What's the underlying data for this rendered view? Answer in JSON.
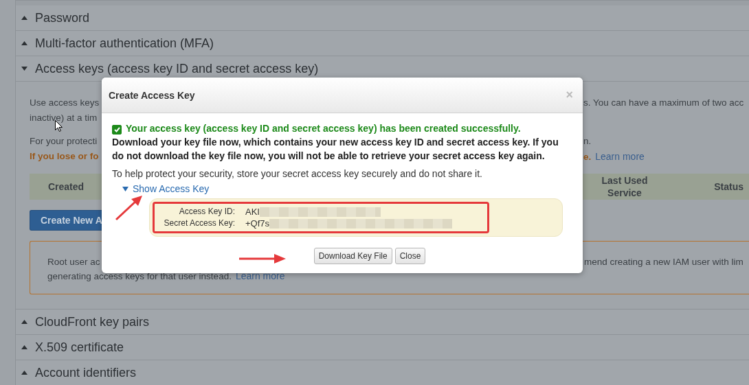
{
  "sections": [
    {
      "title": "Password",
      "expanded": false
    },
    {
      "title": "Multi-factor authentication (MFA)",
      "expanded": false
    },
    {
      "title": "Access keys (access key ID and secret access key)",
      "expanded": true
    },
    {
      "title": "CloudFront key pairs",
      "expanded": false
    },
    {
      "title": "X.509 certificate",
      "expanded": false
    },
    {
      "title": "Account identifiers",
      "expanded": false
    }
  ],
  "access_keys_body": {
    "intro": [
      {
        "left": "Use access keys",
        "right": "s. You can have a maximum of two acc"
      },
      {
        "left": "inactive) at a tim"
      }
    ],
    "protection": {
      "left": "For your protecti",
      "right": "n."
    },
    "warning_line": {
      "left": "If you lose or fo",
      "right": "e.",
      "link": "Learn more"
    },
    "table_columns": [
      "Created",
      "Last Used Service",
      "Status"
    ],
    "create_button": "Create New A",
    "notice": {
      "line1_left": "Root user ac",
      "line1_right": "mend creating a new IAM user with lim",
      "line2": "generating access keys for that user instead.",
      "link": "Learn more"
    }
  },
  "dialog": {
    "title": "Create Access Key",
    "close": "×",
    "success": {
      "checked": true,
      "text": "Your access key (access key ID and secret access key) has been created successfully."
    },
    "warning": "Download your key file now, which contains your new access key ID and secret access key. If you do not download the key file now, you will not be able to retrieve your secret access key again.",
    "info": "To help protect your security, store your secret access key securely and do not share it.",
    "toggle": {
      "label": "Show Access Key",
      "expanded": true
    },
    "keys": [
      {
        "label": "Access Key ID:",
        "value": "AKI"
      },
      {
        "label": "Secret Access Key:",
        "value": "+Qf7s"
      }
    ],
    "buttons": [
      "Download Key File",
      "Close"
    ]
  }
}
